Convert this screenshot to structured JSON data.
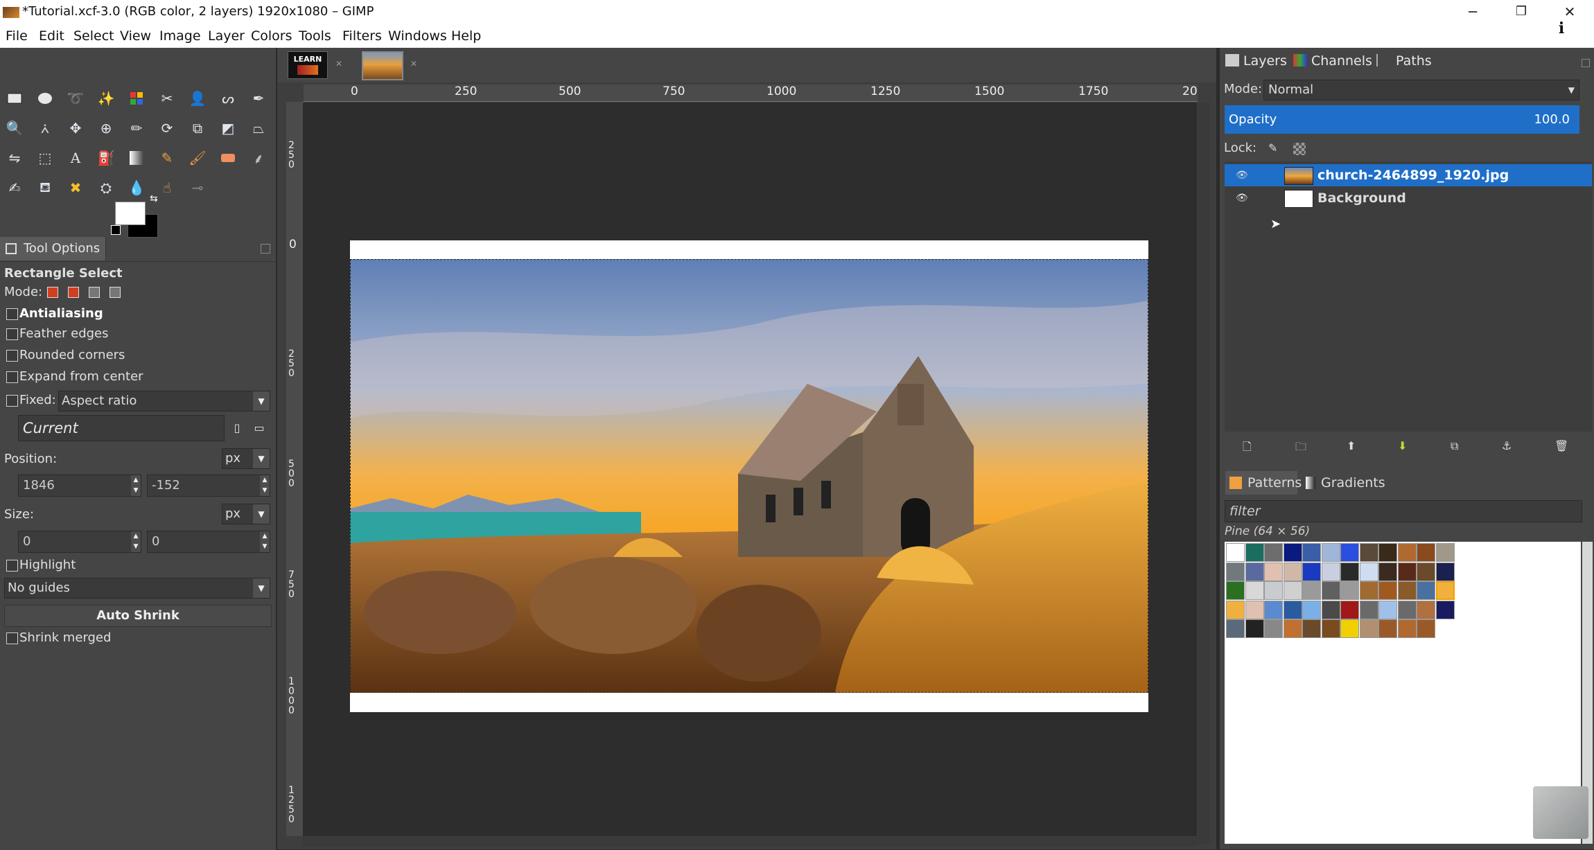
{
  "window": {
    "title": "*Tutorial.xcf-3.0 (RGB color, 2 layers) 1920x1080 – GIMP",
    "minimize": "─",
    "restore": "❐",
    "close": "✕",
    "info": "i"
  },
  "menu": [
    "File",
    "Edit",
    "Select",
    "View",
    "Image",
    "Layer",
    "Colors",
    "Tools",
    "Filters",
    "Windows",
    "Help"
  ],
  "image_tabs": [
    {
      "label": "LEARN"
    },
    {
      "label": ""
    }
  ],
  "ruler": {
    "h_ticks": [
      "0",
      "250",
      "500",
      "750",
      "1000",
      "1250",
      "1500",
      "1750",
      "20"
    ],
    "v_ticks": [
      "2\n5\n0",
      "0",
      "2\n5\n0",
      "5\n0\n0",
      "7\n5\n0",
      "1\n0\n0\n0",
      "1\n2\n5\n0"
    ]
  },
  "tool_options": {
    "tab_label": "Tool Options",
    "tool_name": "Rectangle Select",
    "mode_label": "Mode:",
    "antialiasing": "Antialiasing",
    "feather": "Feather edges",
    "rounded": "Rounded corners",
    "expand": "Expand from center",
    "fixed": "Fixed:",
    "fixed_value": "Aspect ratio",
    "current": "Current",
    "position_label": "Position:",
    "unit": "px",
    "pos_x": "1846",
    "pos_y": "-152",
    "size_label": "Size:",
    "size_w": "0",
    "size_h": "0",
    "highlight": "Highlight",
    "guides": "No guides",
    "auto_shrink": "Auto Shrink",
    "shrink_merged": "Shrink merged"
  },
  "layers_panel": {
    "tabs": [
      "Layers",
      "Channels",
      "Paths"
    ],
    "mode_label": "Mode:",
    "mode_value": "Normal",
    "opacity_label": "Opacity",
    "opacity_value": "100.0",
    "lock_label": "Lock:",
    "layers": [
      {
        "name": "church-2464899_1920.jpg",
        "selected": true
      },
      {
        "name": "Background",
        "selected": false
      }
    ]
  },
  "patterns_panel": {
    "tabs": [
      "Patterns",
      "Gradients"
    ],
    "filter_placeholder": "filter",
    "current_pattern": "Pine (64 × 56)"
  },
  "colors": {
    "accent": "#1f6fc8",
    "panel": "#454545",
    "canvas": "#2d2d2d"
  }
}
